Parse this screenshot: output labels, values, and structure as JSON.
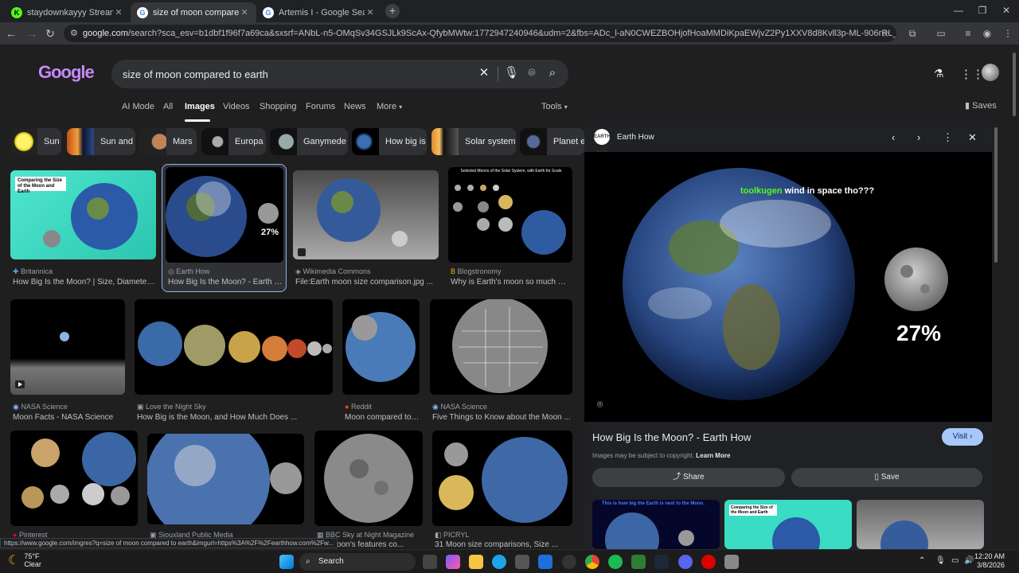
{
  "browser": {
    "tabs": [
      {
        "title": "staydownkayyy Stream - Watch",
        "active": false
      },
      {
        "title": "size of moon compared to earth",
        "active": true
      },
      {
        "title": "Artemis I - Google Search",
        "active": false
      }
    ],
    "url_domain": "google.com",
    "url_rest": "/search?sca_esv=b1dbf1f96f7a69ca&sxsrf=ANbL-n5-OMqSv34GSJLk9ScAx-QfybMWtw:1772947240946&udm=2&fbs=ADc_l-aN0CWEZBOHjofHoaMMDiKpaEWjvZ2Py1XXV8d8Kvll3p-ML-906rRL_m6h4jR-tdCH-vUllZq9RzuaLEcfjf..."
  },
  "search": {
    "logo": "Google",
    "query": "size of moon compared to earth"
  },
  "nav_tabs": [
    "AI Mode",
    "All",
    "Images",
    "Videos",
    "Shopping",
    "Forums",
    "News",
    "More"
  ],
  "tools_label": "Tools",
  "saves_label": "Saves",
  "chips": [
    "Sun",
    "Sun and",
    "Mars",
    "Europa",
    "Ganymede",
    "How big is",
    "Solar system",
    "Planet ea"
  ],
  "results": [
    {
      "source": "Britannica",
      "caption": "How Big Is the Moon? | Size, Diameter ..."
    },
    {
      "source": "Earth How",
      "caption": "How Big Is the Moon? - Earth H..."
    },
    {
      "source": "Wikimedia Commons",
      "caption": "File:Earth moon size comparison.jpg ..."
    },
    {
      "source": "Blogstronomy",
      "caption": "Why is Earth's moon so much big..."
    },
    {
      "source": "NASA Science",
      "caption": "Moon Facts - NASA Science"
    },
    {
      "source": "Love the Night Sky",
      "caption": "How Big is the Moon, and How Much Does ..."
    },
    {
      "source": "Reddit",
      "caption": "Moon compared to ..."
    },
    {
      "source": "NASA Science",
      "caption": "Five Things to Know about the Moon ..."
    },
    {
      "source": "Pinterest",
      "caption": ""
    },
    {
      "source": "Siouxland Public Media",
      "caption": ""
    },
    {
      "source": "BBC Sky at Night Magazine",
      "caption": "...e Moon's features co..."
    },
    {
      "source": "PICRYL",
      "caption": "31 Moon size comparisons, Size ..."
    }
  ],
  "thumb_text": {
    "britannica_title": "Comparing the Size of the Moon and Earth",
    "earthhow_pct": "27%",
    "blog_title": "Selected Moons of the Solar System, with Earth for Scale"
  },
  "preview": {
    "site": "Earth How",
    "site_badge": "EARTH HOW",
    "overlay_text": "wind in space tho???",
    "overlay_brand": "toolkugen",
    "percent": "27%",
    "title": "How Big Is the Moon? - Earth How",
    "visit_label": "Visit",
    "copyright_text": "Images may be subject to copyright.",
    "learn_more": "Learn More",
    "share_label": "Share",
    "save_label": "Save",
    "thumb1_text": "This is how big the Earth is next to the Moon.",
    "thumb2_title": "Comparing the Size of the Moon and Earth"
  },
  "status_url": "https://www.google.com/imgres?q=size of moon compared to earth&imgurl=https%3A%2F%2Fearthhow.com%2Fw...",
  "taskbar": {
    "temp": "75°F",
    "condition": "Clear",
    "search_label": "Search",
    "time": "12:20 AM",
    "date": "3/8/2026"
  },
  "colors": {
    "accent": "#8ab4f8",
    "visit": "#a8c7fa",
    "page_bg": "#1f1f1f"
  }
}
